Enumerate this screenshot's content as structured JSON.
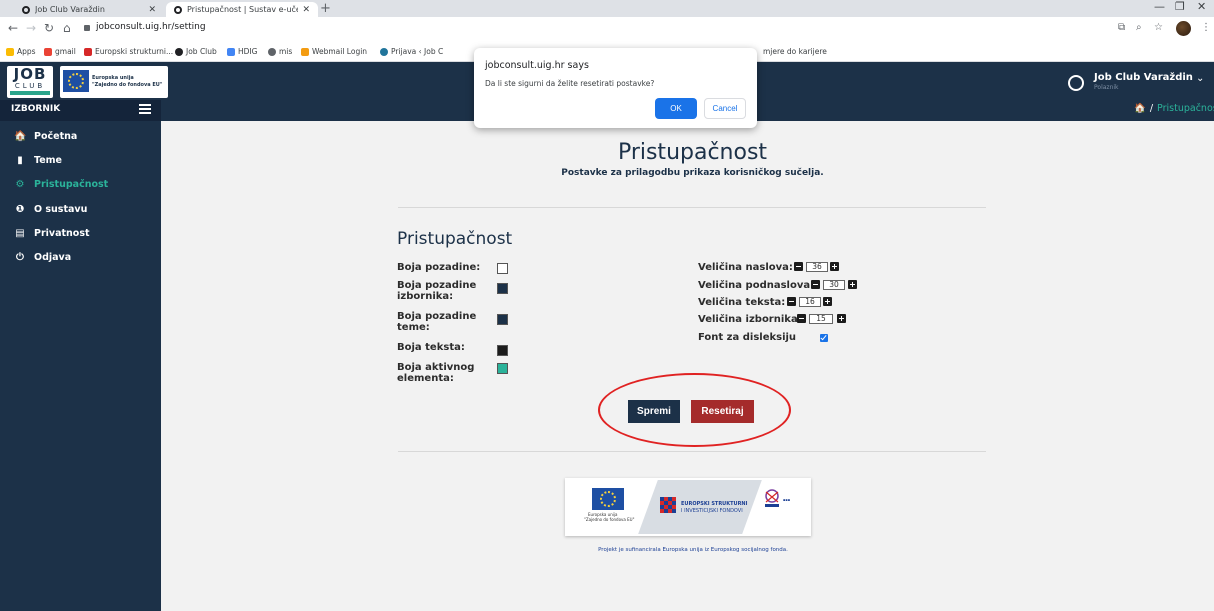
{
  "browser": {
    "tabs": [
      {
        "title": "Job Club Varaždin"
      },
      {
        "title": "Pristupačnost | Sustav e-učenja"
      }
    ],
    "url": "jobconsult.uig.hr/setting",
    "bookmarks": [
      {
        "label": "Apps",
        "color": "#fbbc04"
      },
      {
        "label": "gmail",
        "color": "#ea4335"
      },
      {
        "label": "Europski strukturni...",
        "color": "#d62828"
      },
      {
        "label": "Job Club",
        "color": "#202124"
      },
      {
        "label": "HDIG",
        "color": "#4285f4"
      },
      {
        "label": "mis",
        "color": "#5f6368"
      },
      {
        "label": "Webmail Login",
        "color": "#f39c12"
      },
      {
        "label": "Prijava ‹ Job C",
        "color": "#21759b"
      }
    ],
    "bookmark_tail": "mjere do karijere"
  },
  "header": {
    "logo_job": "JOB",
    "logo_club": "CLUB",
    "eu_line1": "Europska unija",
    "eu_line2": "\"Zajedno do fondova EU\"",
    "user_name": "Job Club Varaždin",
    "user_role": "Polaznik"
  },
  "sidebar": {
    "title": "IZBORNIK",
    "items": [
      {
        "label": "Početna",
        "icon": "home-icon",
        "glyph": "🏠"
      },
      {
        "label": "Teme",
        "icon": "book-icon",
        "glyph": "▮"
      },
      {
        "label": "Pristupačnost",
        "icon": "gear-icon",
        "glyph": "⚙",
        "active": true
      },
      {
        "label": "O sustavu",
        "icon": "info-icon",
        "glyph": "❶"
      },
      {
        "label": "Privatnost",
        "icon": "document-icon",
        "glyph": "▤"
      },
      {
        "label": "Odjava",
        "icon": "power-icon",
        "glyph": "⏻"
      }
    ]
  },
  "breadcrumb": {
    "current": "Pristupačnost"
  },
  "main": {
    "title": "Pristupačnost",
    "subtitle": "Postavke za prilagodbu prikaza korisničkog sučelja.",
    "section_title": "Pristupačnost",
    "colors": [
      {
        "label": "Boja pozadine:",
        "value": "#ffffff"
      },
      {
        "label": "Boja pozadine izbornika:",
        "value": "#1c3148"
      },
      {
        "label": "Boja pozadine teme:",
        "value": "#1c3148"
      },
      {
        "label": "Boja teksta:",
        "value": "#1c1c1c"
      },
      {
        "label": "Boja aktivnog elementa:",
        "value": "#2bb39a"
      }
    ],
    "sizes": [
      {
        "label": "Veličina naslova:",
        "value": "36"
      },
      {
        "label": "Veličina podnaslova:",
        "value": "30"
      },
      {
        "label": "Veličina teksta:",
        "value": "16"
      },
      {
        "label": "Veličina izbornika:",
        "value": "15"
      }
    ],
    "dyslexia_label": "Font za disleksiju",
    "dyslexia_checked": true,
    "save_label": "Spremi",
    "reset_label": "Resetiraj"
  },
  "footer": {
    "eu_t1": "Europska unija",
    "eu_t2": "\"Zajedno do fondova EU\"",
    "strukturni_1": "EUROPSKI STRUKTURNI",
    "strukturni_2": "I INVESTICIJSKI FONDOVI",
    "note": "Projekt je sufinancirala Europska unija iz Europskog socijalnog fonda."
  },
  "dialog": {
    "title": "jobconsult.uig.hr says",
    "message": "Da li ste sigurni da želite resetirati postavke?",
    "ok_label": "OK",
    "cancel_label": "Cancel"
  }
}
